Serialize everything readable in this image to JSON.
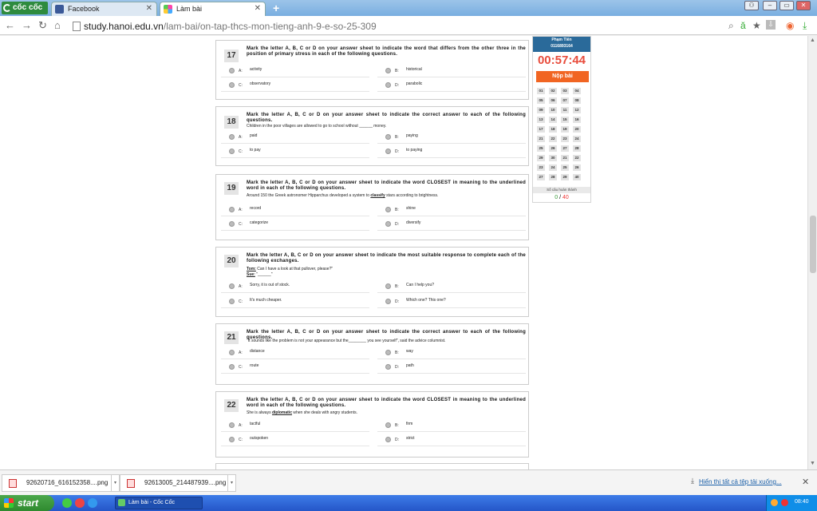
{
  "browser": {
    "brand": "cốc cốc",
    "tabs": [
      {
        "title": "Facebook",
        "active": false
      },
      {
        "title": "Làm bài",
        "active": true
      }
    ],
    "url_host": "study.hanoi.edu.vn",
    "url_path": "/lam-bai/on-tap-thcs-mon-tieng-anh-9-e-so-25-309"
  },
  "questions": [
    {
      "number": "17",
      "instruction": "Mark the letter A, B, C or D on your answer sheet to indicate the word that differs from the other three in the position of primary stress in each of the following questions.",
      "stem": "",
      "options": [
        {
          "label": "A:",
          "text": "activity"
        },
        {
          "label": "B:",
          "text": "historical"
        },
        {
          "label": "C:",
          "text": "observatory"
        },
        {
          "label": "D:",
          "text": "parabolic"
        }
      ]
    },
    {
      "number": "18",
      "instruction": "Mark the letter A, B, C or D on your answer sheet to indicate the correct answer to each of the following questions.",
      "stem": "Children in the poor villages are allowed to go to school without ______ money.",
      "options": [
        {
          "label": "A:",
          "text": "paid"
        },
        {
          "label": "B:",
          "text": "paying"
        },
        {
          "label": "C:",
          "text": "to pay"
        },
        {
          "label": "D:",
          "text": "to paying"
        }
      ]
    },
    {
      "number": "19",
      "instruction": "Mark the letter A, B, C or D on your answer sheet to indicate the word CLOSEST in meaning to the underlined word in each of the following questions.",
      "stem_before": "Around 150 the Greek astronomer Hipparchus developed a system to ",
      "stem_key": "classify",
      "stem_after": " stars according to brightness.",
      "options": [
        {
          "label": "A:",
          "text": "record"
        },
        {
          "label": "B:",
          "text": "shine"
        },
        {
          "label": "C:",
          "text": "categorize"
        },
        {
          "label": "D:",
          "text": "diversify"
        }
      ]
    },
    {
      "number": "20",
      "instruction": "Mark the letter A, B, C or D on your answer sheet to indicate the most suitable response to complete each of the following exchanges.",
      "dialogue": [
        {
          "speaker": "Tom:",
          "line": "Can I have a look at that pullover, please?\""
        },
        {
          "speaker": "Sue:",
          "line": "\"______\""
        }
      ],
      "options": [
        {
          "label": "A:",
          "text": "Sorry, it is out of stock."
        },
        {
          "label": "B:",
          "text": "Can I help you?"
        },
        {
          "label": "C:",
          "text": "It's much cheaper."
        },
        {
          "label": "D:",
          "text": "Which one? This one?"
        }
      ]
    },
    {
      "number": "21",
      "instruction": "Mark the letter A, B, C or D on your answer sheet to indicate the correct answer to each of the following questions.",
      "stem": "\"It sounds like the problem is not your appearance but the________ you see yourself\", said the advice columnist.",
      "options": [
        {
          "label": "A:",
          "text": "distance"
        },
        {
          "label": "B:",
          "text": "way"
        },
        {
          "label": "C:",
          "text": "route"
        },
        {
          "label": "D:",
          "text": "path"
        }
      ]
    },
    {
      "number": "22",
      "instruction": "Mark the letter A, B, C or D on your answer sheet to indicate the word CLOSEST in meaning to the underlined word in each of the following questions.",
      "stem_before": "She is always ",
      "stem_key": "diplomatic",
      "stem_after": " when she deals with angry students.",
      "options": [
        {
          "label": "A:",
          "text": "tactful"
        },
        {
          "label": "B:",
          "text": "firm"
        },
        {
          "label": "C:",
          "text": "outspoken"
        },
        {
          "label": "D:",
          "text": "strict"
        }
      ]
    }
  ],
  "panel": {
    "student_name": "Phạm Tiến",
    "student_id": "0116893164",
    "timer": "00:57:44",
    "submit_label": "Nộp bài",
    "grid": [
      "01",
      "02",
      "03",
      "04",
      "05",
      "06",
      "07",
      "08",
      "09",
      "10",
      "11",
      "12",
      "13",
      "14",
      "15",
      "16",
      "17",
      "18",
      "19",
      "20",
      "21",
      "22",
      "23",
      "24",
      "25",
      "26",
      "27",
      "28",
      "29",
      "30",
      "21",
      "22",
      "23",
      "24",
      "25",
      "26",
      "27",
      "28",
      "29",
      "40"
    ],
    "done_label": "Số câu hoàn thành",
    "done_count": "0",
    "total_count": "40"
  },
  "downloads": {
    "items": [
      {
        "name": "92620716_616152358....png"
      },
      {
        "name": "92613005_214487939....png"
      }
    ],
    "show_all": "Hiển thị tất cả tệp tải xuống..."
  },
  "taskbar": {
    "start_label": "start",
    "app_label": "Làm bài - Cốc Cốc",
    "clock": "08:40"
  }
}
